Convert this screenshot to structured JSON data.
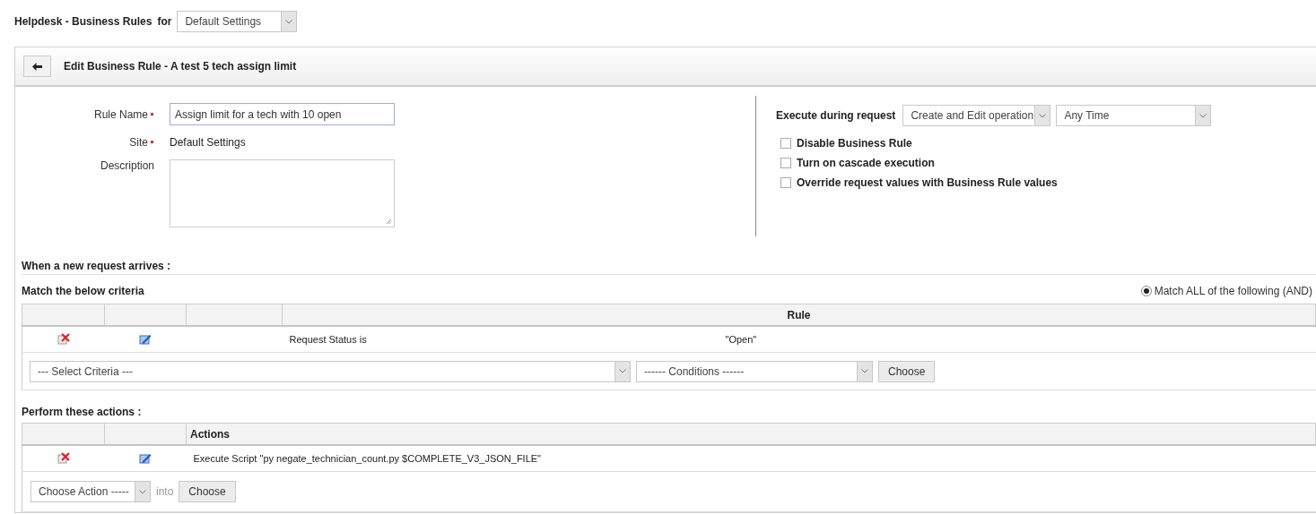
{
  "header": {
    "title": "Helpdesk - Business Rules",
    "for_label": "for",
    "site_select": "Default Settings"
  },
  "panel": {
    "title": "Edit Business Rule - A test 5 tech assign limit"
  },
  "form": {
    "fields": [
      {
        "kind": "input",
        "label": "Rule Name",
        "required": true,
        "value": "Assign limit for a tech with 10 open"
      },
      {
        "kind": "text",
        "label": "Site",
        "required": true,
        "value": "Default Settings"
      },
      {
        "kind": "textarea",
        "label": "Description",
        "required": false
      }
    ]
  },
  "execution": {
    "label": "Execute during request",
    "operation_select": "Create and Edit operation",
    "time_select": "Any Time",
    "options": [
      {
        "label": "Disable Business Rule",
        "checked": false
      },
      {
        "label": "Turn on cascade execution",
        "checked": false
      },
      {
        "label": "Override request values with Business Rule values",
        "checked": false
      }
    ]
  },
  "criteria": {
    "heading": "When a new request arrives :",
    "subheading": "Match the below criteria",
    "match_option": {
      "label": "Match ALL of the following (AND)",
      "selected": true
    },
    "rule_column": "Rule",
    "rows": [
      {
        "field": "Request Status is",
        "value": "\"Open\""
      }
    ],
    "criteria_select": "--- Select Criteria ---",
    "conditions_select": "------ Conditions ------",
    "choose_button": "Choose"
  },
  "actions": {
    "heading": "Perform these actions :",
    "actions_column": "Actions",
    "rows": [
      {
        "text": "Execute Script \"py negate_technician_count.py $COMPLETE_V3_JSON_FILE\""
      }
    ],
    "action_select": "Choose Action -----",
    "into_label": "into",
    "choose_button": "Choose"
  }
}
